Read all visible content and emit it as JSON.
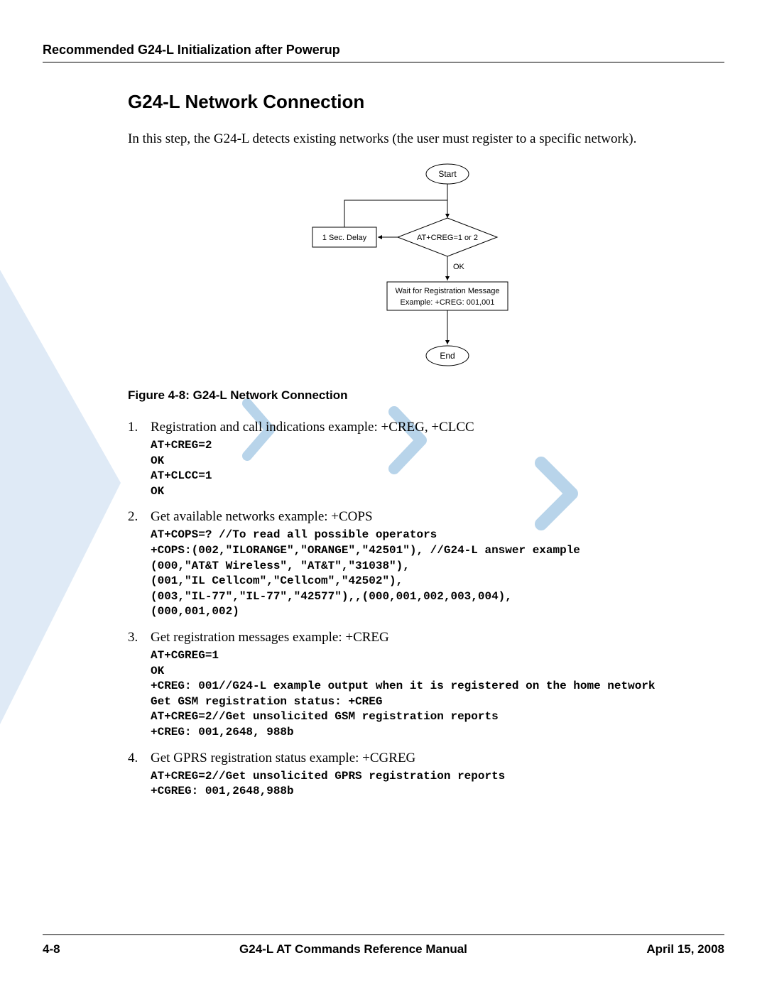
{
  "header": {
    "running_title": "Recommended G24-L Initialization after Powerup"
  },
  "section": {
    "heading": "G24-L Network Connection",
    "intro": "In this step, the G24-L detects existing networks (the user must register to a specific network)."
  },
  "flowchart": {
    "start": "Start",
    "decision": "AT+CREG=1 or 2",
    "delay": "1 Sec. Delay",
    "ok": "OK",
    "wait_line1": "Wait for Registration Message",
    "wait_line2": "Example: +CREG: 001,001",
    "end": "End"
  },
  "figure_caption": "Figure 4-8: G24-L Network Connection",
  "steps": [
    {
      "title": "Registration and call indications example: +CREG, +CLCC",
      "code": "AT+CREG=2\nOK\nAT+CLCC=1\nOK"
    },
    {
      "title": "Get available networks example: +COPS",
      "code": "AT+COPS=? //To read all possible operators\n+COPS:(002,\"ILORANGE\",\"ORANGE\",\"42501\"), //G24-L answer example\n(000,\"AT&T Wireless\", \"AT&T\",\"31038\"),\n(001,\"IL Cellcom\",\"Cellcom\",\"42502\"),\n(003,\"IL-77\",\"IL-77\",\"42577\"),,(000,001,002,003,004),\n(000,001,002)"
    },
    {
      "title": "Get registration messages example: +CREG",
      "code": "AT+CGREG=1\nOK\n+CREG: 001//G24-L example output when it is registered on the home network\nGet GSM registration status: +CREG\nAT+CREG=2//Get unsolicited GSM registration reports\n+CREG: 001,2648, 988b"
    },
    {
      "title": "Get GPRS registration status example: +CGREG",
      "code": "AT+CREG=2//Get unsolicited GPRS registration reports\n+CGREG: 001,2648,988b"
    }
  ],
  "footer": {
    "page": "4-8",
    "manual": "G24-L AT Commands Reference Manual",
    "date": "April 15, 2008"
  }
}
